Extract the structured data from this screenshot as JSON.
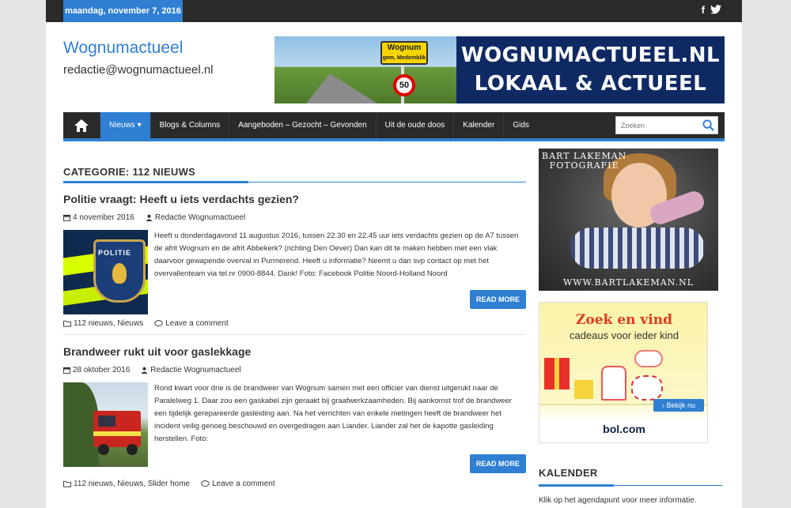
{
  "topbar": {
    "date": "maandag, november 7, 2016",
    "social": {
      "facebook": "f",
      "twitter": "🐦"
    }
  },
  "site": {
    "title": "Wognumactueel",
    "email": "redactie@wognumactueel.nl"
  },
  "banner": {
    "line1": "WOGNUMACTUEEL.NL",
    "line2": "LOKAAL & ACTUEEL",
    "sign_name": "Wognum",
    "sign_sub": "gem. Medemblik",
    "speed": "50"
  },
  "nav": {
    "items": [
      {
        "label": "Nieuws ▾",
        "active": true
      },
      {
        "label": "Blogs & Columns"
      },
      {
        "label": "Aangeboden – Gezocht – Gevonden"
      },
      {
        "label": "Uit de oude doos"
      },
      {
        "label": "Kalender"
      },
      {
        "label": "Gids"
      }
    ],
    "search_placeholder": "Zoeken"
  },
  "category": {
    "heading": "CATEGORIE: 112 NIEUWS"
  },
  "posts": [
    {
      "title": "Politie vraagt: Heeft u iets verdachts gezien?",
      "date": "4 november 2016",
      "author": "Redactie Wognumactueel",
      "excerpt": "Heeft u donderdagavond 11 augustus 2016, tussen 22.30 en 22.45 uur iets verdachts gezien op de A7 tussen de afrit Wognum en de afrit Abbekerk? (richting Den Oever) Dan kan dit te maken hebben met een vlak daarvoor gewapende overval in Purmerend. Heeft u informatie? Neemt u dan svp contact op met het overvallenteam via tel.nr 0900-8844. Dank! Foto: Facebook Politie Noord-Holland Noord",
      "read_more": "READ MORE",
      "categories": "112 nieuws, Nieuws",
      "comment": "Leave a comment",
      "thumb_text": "POLITIE"
    },
    {
      "title": "Brandweer rukt uit voor gaslekkage",
      "date": "28 oktober 2016",
      "author": "Redactie Wognumactueel",
      "excerpt": "Rond kwart voor drie is de brandweer van Wognum samen met een officier van dienst uitgerukt naar de Paralelweg 1. Daar zou een gaskabel zijn geraakt bij graafwerkzaamheden. Bij aankomst trof de brandweer een tijdelijk gerepareerde gasleiding aan. Na het verrichten van enkele metingen heeft de brandweer het incident veilig genoeg beschouwd en overgedragen aan Liander. Liander zal het de kapotte gasleiding herstellen. Foto:",
      "read_more": "READ MORE",
      "categories": "112 nieuws, Nieuws, Slider home",
      "comment": "Leave a comment"
    }
  ],
  "sidebar": {
    "photo_top": "BART LAKEMAN\nFOTOGRAFIE",
    "photo_bottom": "WWW.BARTLAKEMAN.NL",
    "ad_title": "Zoek en vind",
    "ad_sub": "cadeaus voor ieder kind",
    "ad_button": "›  Bekijk nu",
    "ad_logo": "bol.com",
    "kalender_heading": "KALENDER",
    "kalender_text": "Klik op het agendapunt voor meer informatie."
  }
}
